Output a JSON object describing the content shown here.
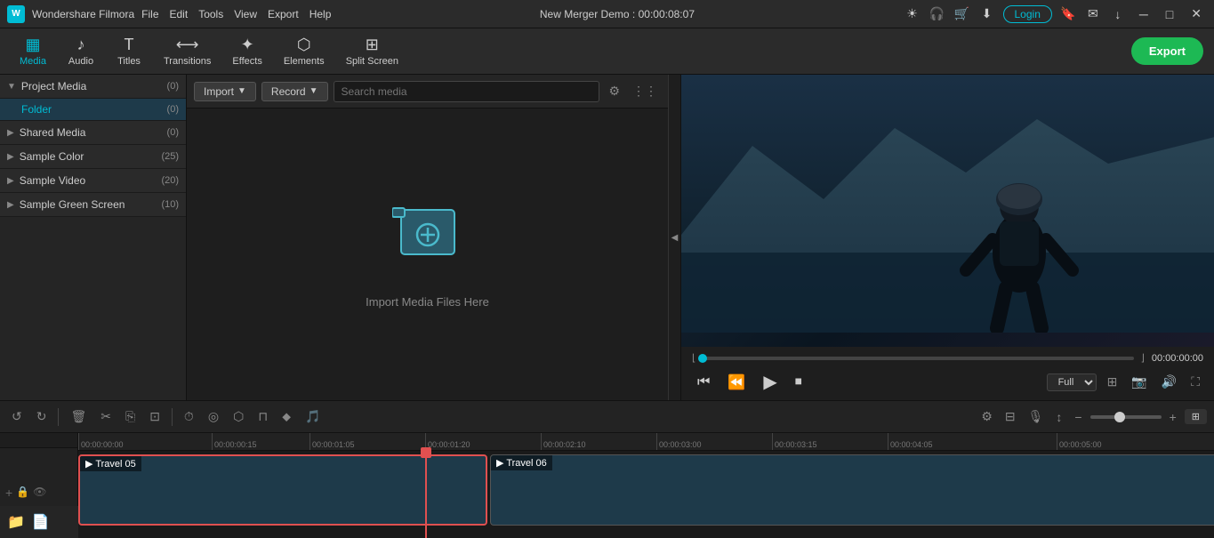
{
  "app": {
    "name": "Wondershare Filmora",
    "project": "New Merger Demo",
    "time": "00:00:08:07"
  },
  "titlebar": {
    "menus": [
      "File",
      "Edit",
      "Tools",
      "View",
      "Export",
      "Help"
    ],
    "login_label": "Login",
    "icons": [
      "brightness",
      "headphone",
      "cart",
      "download",
      "minimize",
      "maximize",
      "close"
    ]
  },
  "toolbar": {
    "items": [
      {
        "id": "media",
        "label": "Media",
        "icon": "▦"
      },
      {
        "id": "audio",
        "label": "Audio",
        "icon": "♪"
      },
      {
        "id": "titles",
        "label": "Titles",
        "icon": "T"
      },
      {
        "id": "transitions",
        "label": "Transitions",
        "icon": "⟷"
      },
      {
        "id": "effects",
        "label": "Effects",
        "icon": "✦"
      },
      {
        "id": "elements",
        "label": "Elements",
        "icon": "⬡"
      },
      {
        "id": "splitscreen",
        "label": "Split Screen",
        "icon": "⊞"
      }
    ],
    "export_label": "Export"
  },
  "sidebar": {
    "sections": [
      {
        "id": "project-media",
        "label": "Project Media",
        "count": "(0)",
        "expanded": true,
        "children": [
          {
            "id": "folder",
            "label": "Folder",
            "count": "(0)",
            "active": true
          }
        ]
      },
      {
        "id": "shared-media",
        "label": "Shared Media",
        "count": "(0)",
        "expanded": false,
        "children": []
      },
      {
        "id": "sample-color",
        "label": "Sample Color",
        "count": "(25)",
        "expanded": false,
        "children": []
      },
      {
        "id": "sample-video",
        "label": "Sample Video",
        "count": "(20)",
        "expanded": false,
        "children": []
      },
      {
        "id": "sample-green",
        "label": "Sample Green Screen",
        "count": "(10)",
        "expanded": false,
        "children": []
      }
    ]
  },
  "media_panel": {
    "import_label": "Import",
    "record_label": "Record",
    "search_placeholder": "Search media",
    "empty_text": "Import Media Files Here"
  },
  "preview": {
    "time": "00:00:00:00",
    "quality": "Full",
    "progress": 0
  },
  "timeline": {
    "timecodes": [
      "00:00:00:00",
      "00:00:00:15",
      "00:00:01:05",
      "00:00:01:20",
      "00:00:02:10",
      "00:00:03:00",
      "00:00:03:15",
      "00:00:04:05",
      "00:00:05:00"
    ],
    "clips": [
      {
        "id": "clip1",
        "label": "Travel 05",
        "selected": true
      },
      {
        "id": "clip2",
        "label": "Travel 06",
        "selected": false
      }
    ]
  }
}
